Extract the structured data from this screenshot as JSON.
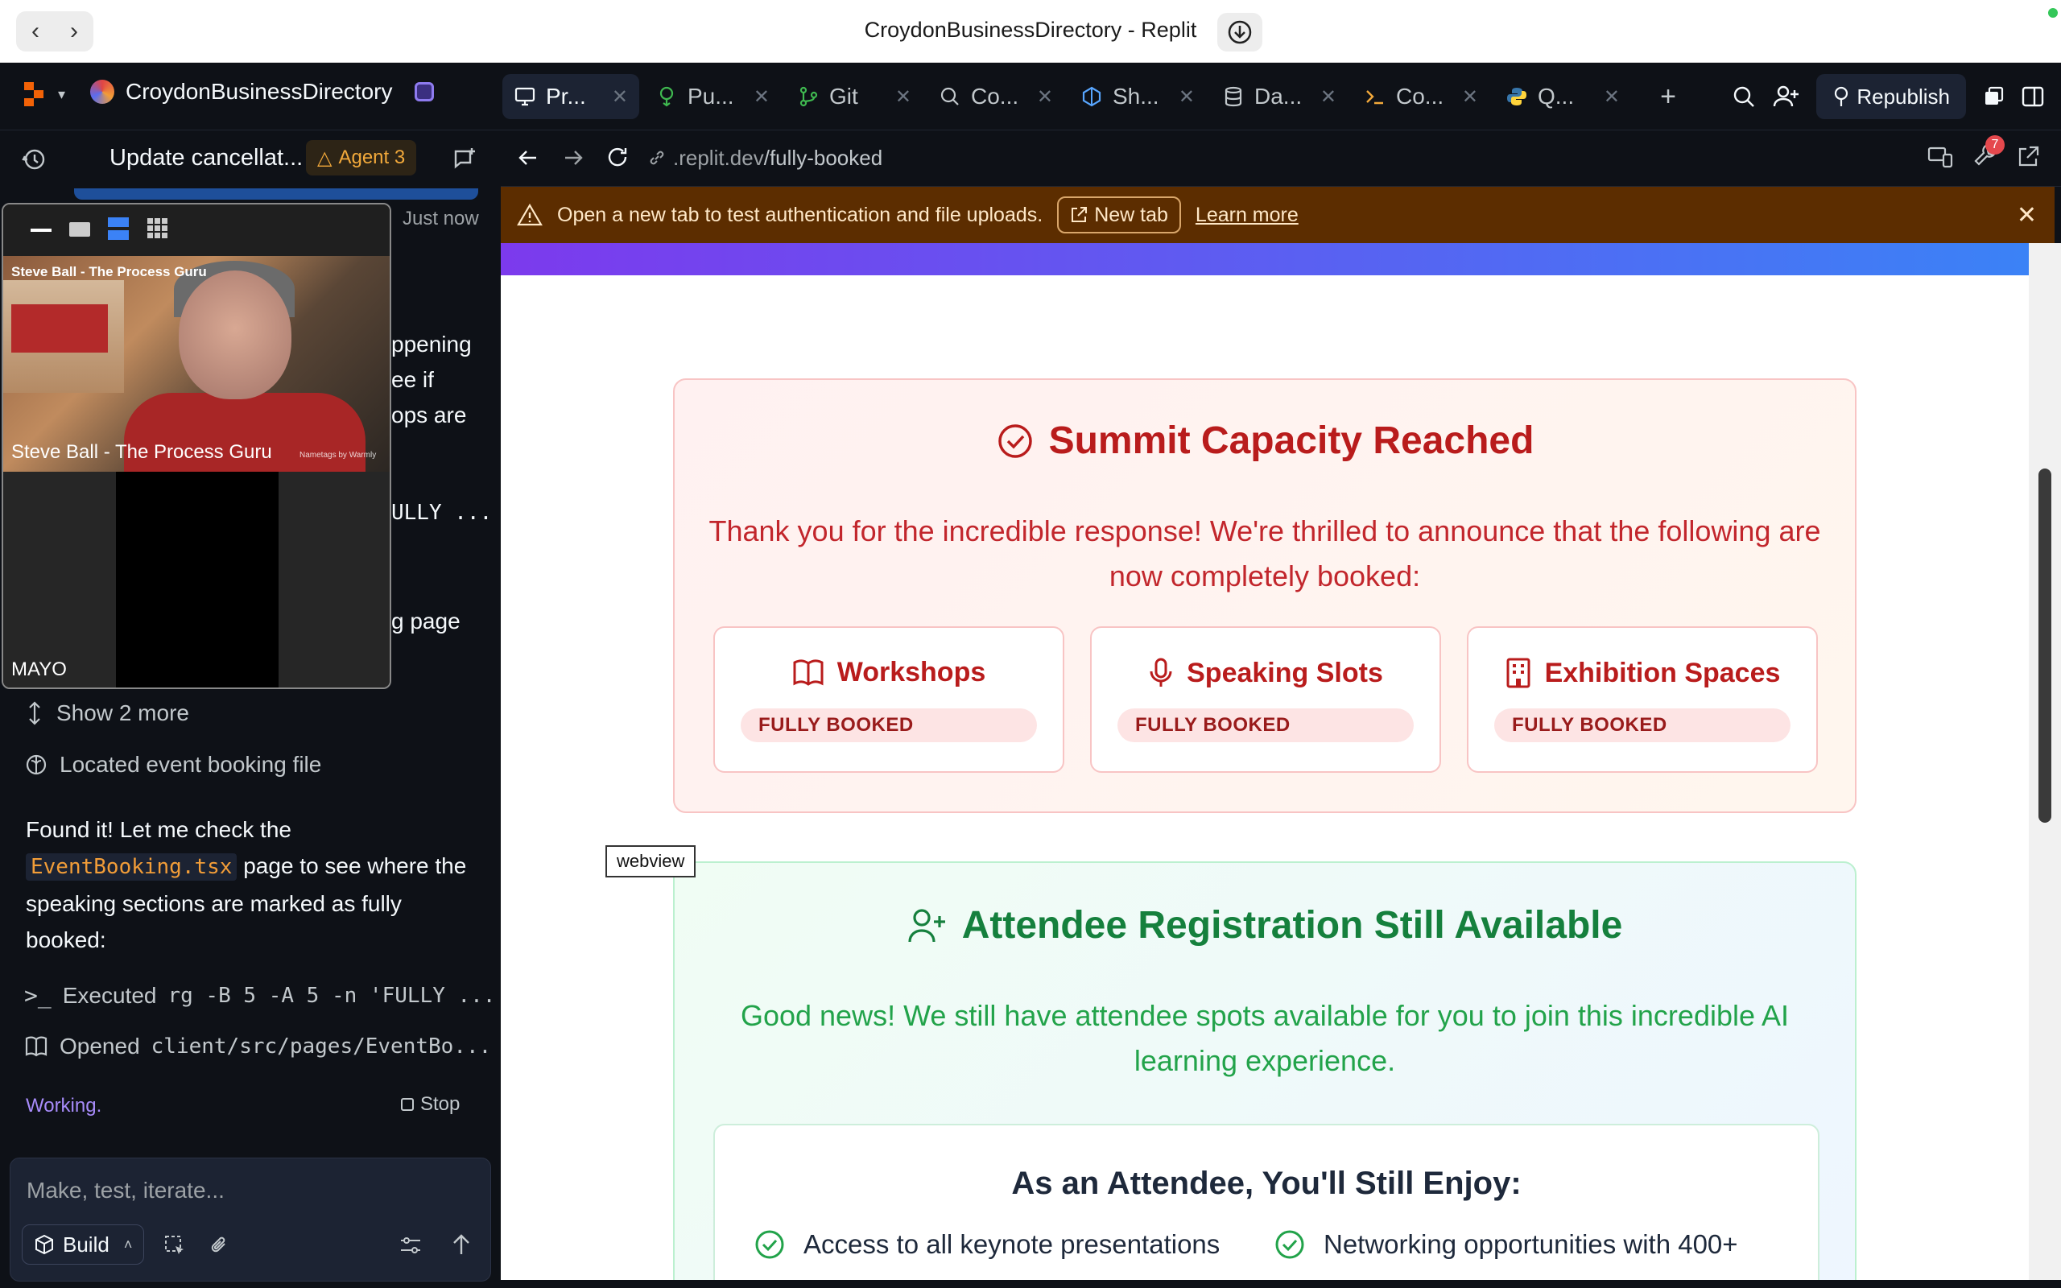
{
  "window": {
    "title": "CroydonBusinessDirectory - Replit"
  },
  "topbar": {
    "project_name": "CroydonBusinessDirectory",
    "tabs": [
      {
        "label": "Pr...",
        "icon": "monitor-icon"
      },
      {
        "label": "Pu...",
        "icon": "publish-icon"
      },
      {
        "label": "Git",
        "icon": "git-icon"
      },
      {
        "label": "Co...",
        "icon": "search-icon"
      },
      {
        "label": "Sh...",
        "icon": "shell-icon"
      },
      {
        "label": "Da...",
        "icon": "database-icon"
      },
      {
        "label": "Co...",
        "icon": "terminal-icon"
      },
      {
        "label": "Q...",
        "icon": "python-icon"
      }
    ],
    "republish_label": "Republish"
  },
  "agent": {
    "title": "Update cancellat...",
    "chip_label": "Agent 3",
    "timestamp": "Just now",
    "partial_lines": [
      "ppening",
      "ee if",
      "ops are",
      "ULLY ...",
      "g page"
    ],
    "show_more": "Show 2 more",
    "located": "Located event booking file",
    "message_prefix": "Found it! Let me check the",
    "message_code": "EventBooking.tsx",
    "message_suffix": "page to see where the speaking sections are marked as fully booked:",
    "executed_label": "Executed",
    "executed_cmd": "rg -B 5 -A 5 -n 'FULLY ...",
    "opened_label": "Opened",
    "opened_path": "client/src/pages/EventBo...",
    "status": "Working.",
    "stop_label": "Stop",
    "input_placeholder": "Make, test, iterate...",
    "build_label": "Build"
  },
  "video": {
    "name_top": "Steve Ball - The Process Guru",
    "name_bottom": "Steve Ball - The Process Guru",
    "nametag": "Nametags by Warmly",
    "second_participant": "MAYO"
  },
  "preview": {
    "url_host": ".replit.dev",
    "url_path": "/fully-booked",
    "notification_count": "7",
    "banner_text": "Open a new tab to test authentication and file uploads.",
    "new_tab_label": "New tab",
    "learn_more_label": "Learn more",
    "webview_tooltip": "webview"
  },
  "page": {
    "capacity_title": "Summit Capacity Reached",
    "capacity_text": "Thank you for the incredible response! We're thrilled to announce that the following are now completely booked:",
    "cards": [
      {
        "title": "Workshops",
        "icon": "book-icon",
        "badge": "FULLY BOOKED"
      },
      {
        "title": "Speaking Slots",
        "icon": "microphone-icon",
        "badge": "FULLY BOOKED"
      },
      {
        "title": "Exhibition Spaces",
        "icon": "building-icon",
        "badge": "FULLY BOOKED"
      }
    ],
    "attendee_title": "Attendee Registration Still Available",
    "attendee_text": "Good news! We still have attendee spots available for you to join this incredible AI learning experience.",
    "enjoy_title": "As an Attendee, You'll Still Enjoy:",
    "enjoy_items": [
      "Access to all keynote presentations",
      "Networking opportunities with 400+"
    ]
  },
  "colors": {
    "accent_red": "#b91c1c",
    "accent_green": "#15803d",
    "banner_bg": "#5c2d00",
    "agent_chip": "#f2a93b"
  }
}
